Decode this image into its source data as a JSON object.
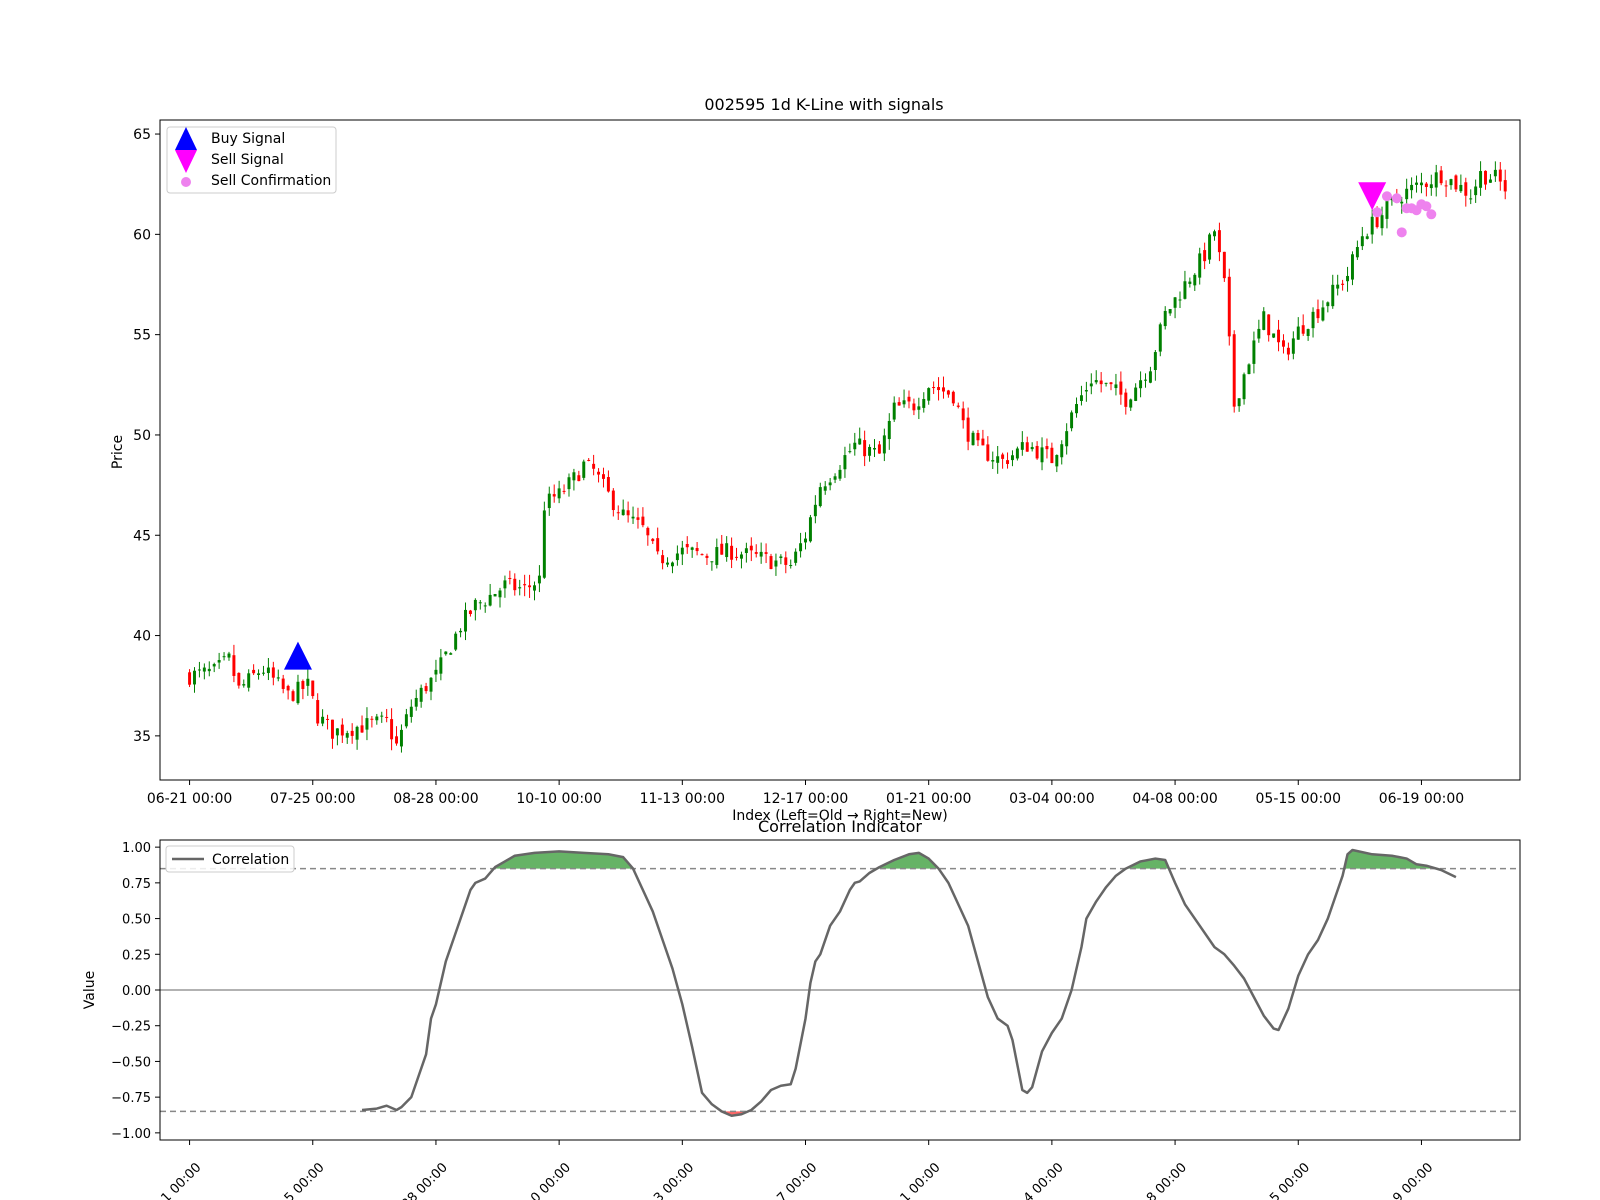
{
  "chart_data": [
    {
      "type": "candlestick",
      "title": "002595 1d K-Line with signals",
      "xlabel": "Index (Left=Old → Right=New)",
      "ylabel": "Price",
      "xlim": [
        -6,
        270
      ],
      "ylim": [
        32.8,
        65.7
      ],
      "yticks": [
        35,
        40,
        45,
        50,
        55,
        60,
        65
      ],
      "xtick_positions": [
        0,
        25,
        50,
        75,
        100,
        125,
        150,
        175,
        200,
        225,
        250
      ],
      "xtick_labels": [
        "06-21 00:00",
        "07-25 00:00",
        "08-28 00:00",
        "10-10 00:00",
        "11-13 00:00",
        "12-17 00:00",
        "01-21 00:00",
        "03-04 00:00",
        "04-08 00:00",
        "05-15 00:00",
        "06-19 00:00"
      ],
      "price_path": [
        [
          0,
          38.0
        ],
        [
          5,
          38.2
        ],
        [
          8,
          38.8
        ],
        [
          10,
          37.3
        ],
        [
          14,
          38.2
        ],
        [
          15,
          38.3
        ],
        [
          20,
          37.0
        ],
        [
          24,
          37.5
        ],
        [
          26,
          36.0
        ],
        [
          29,
          35.2
        ],
        [
          35,
          35.5
        ],
        [
          40,
          35.7
        ],
        [
          42,
          34.5
        ],
        [
          45,
          36.5
        ],
        [
          48,
          37.5
        ],
        [
          50,
          38.0
        ],
        [
          55,
          40.5
        ],
        [
          58,
          41.5
        ],
        [
          60,
          41.8
        ],
        [
          64,
          42.5
        ],
        [
          68,
          42.3
        ],
        [
          71,
          42.8
        ],
        [
          72,
          46.5
        ],
        [
          74,
          46.9
        ],
        [
          75,
          47.0
        ],
        [
          78,
          47.8
        ],
        [
          80,
          48.5
        ],
        [
          82,
          48.2
        ],
        [
          85,
          47.0
        ],
        [
          88,
          46.0
        ],
        [
          92,
          45.3
        ],
        [
          95,
          43.8
        ],
        [
          100,
          44.2
        ],
        [
          105,
          44.0
        ],
        [
          110,
          44.2
        ],
        [
          115,
          43.9
        ],
        [
          122,
          43.5
        ],
        [
          125,
          45.0
        ],
        [
          128,
          47.5
        ],
        [
          130,
          48.0
        ],
        [
          135,
          49.5
        ],
        [
          140,
          49.0
        ],
        [
          143,
          51.3
        ],
        [
          147,
          51.5
        ],
        [
          150,
          52.5
        ],
        [
          155,
          52.0
        ],
        [
          157,
          50.5
        ],
        [
          160,
          49.3
        ],
        [
          165,
          48.7
        ],
        [
          170,
          49.5
        ],
        [
          175,
          48.8
        ],
        [
          180,
          51.5
        ],
        [
          183,
          52.8
        ],
        [
          187,
          52.3
        ],
        [
          190,
          51.8
        ],
        [
          195,
          53.5
        ],
        [
          198,
          56.0
        ],
        [
          202,
          57.5
        ],
        [
          206,
          59.0
        ],
        [
          208,
          60.2
        ],
        [
          210,
          57.5
        ],
        [
          212,
          51.5
        ],
        [
          215,
          53.8
        ],
        [
          218,
          55.8
        ],
        [
          222,
          54.0
        ],
        [
          225,
          55.2
        ],
        [
          230,
          56.5
        ],
        [
          235,
          58.0
        ],
        [
          238,
          60.0
        ],
        [
          242,
          61.0
        ],
        [
          246,
          62.0
        ],
        [
          250,
          62.5
        ],
        [
          254,
          63.0
        ],
        [
          257,
          62.5
        ],
        [
          260,
          62.0
        ],
        [
          262,
          63.0
        ],
        [
          265,
          62.8
        ],
        [
          267,
          62.3
        ]
      ],
      "candles_count": 268,
      "up_color": "#008000",
      "down_color": "#ff0000",
      "signals": [
        {
          "name": "Buy Signal",
          "marker": "triangle-up",
          "color": "#0000ff",
          "points": [
            [
              22,
              38.9
            ]
          ]
        },
        {
          "name": "Sell Signal",
          "marker": "triangle-down",
          "color": "#ff00ff",
          "points": [
            [
              240,
              62.0
            ]
          ]
        },
        {
          "name": "Sell Confirmation",
          "marker": "circle",
          "color": "#ee82ee",
          "points": [
            [
              241,
              61.1
            ],
            [
              243,
              61.9
            ],
            [
              245,
              61.8
            ],
            [
              246,
              60.1
            ],
            [
              247,
              61.3
            ],
            [
              248,
              61.3
            ],
            [
              249,
              61.2
            ],
            [
              250,
              61.5
            ],
            [
              251,
              61.4
            ],
            [
              252,
              61.0
            ]
          ]
        }
      ],
      "legend": {
        "position": "upper-left",
        "entries": [
          "Buy Signal",
          "Sell Signal",
          "Sell Confirmation"
        ]
      }
    },
    {
      "type": "line",
      "title": "Correlation Indicator",
      "xlabel": "",
      "ylabel": "Value",
      "xlim": [
        -6,
        270
      ],
      "ylim": [
        -1.05,
        1.05
      ],
      "yticks": [
        -1.0,
        -0.75,
        -0.5,
        -0.25,
        0.0,
        0.25,
        0.5,
        0.75,
        1.0
      ],
      "ytick_labels": [
        "−1.00",
        "−0.75",
        "−0.50",
        "−0.25",
        "0.00",
        "0.25",
        "0.50",
        "0.75",
        "1.00"
      ],
      "xtick_labels_visible": [
        "1 00:00",
        "5 00:00",
        "28 00:00",
        "0 00:00",
        "3 00:00",
        "7 00:00",
        "1 00:00",
        "4 00:00",
        "8 00:00",
        "5 00:00",
        "9 00:00"
      ],
      "xtick_positions": [
        0,
        25,
        50,
        75,
        100,
        125,
        150,
        175,
        200,
        225,
        250
      ],
      "thresholds": [
        0.85,
        -0.85
      ],
      "zero_line": 0.0,
      "series": [
        {
          "name": "Correlation",
          "color": "#666666",
          "points": [
            [
              35,
              -0.84
            ],
            [
              38,
              -0.83
            ],
            [
              40,
              -0.81
            ],
            [
              42,
              -0.84
            ],
            [
              43,
              -0.82
            ],
            [
              45,
              -0.75
            ],
            [
              46,
              -0.65
            ],
            [
              48,
              -0.45
            ],
            [
              49,
              -0.2
            ],
            [
              50,
              -0.1
            ],
            [
              52,
              0.2
            ],
            [
              54,
              0.4
            ],
            [
              56,
              0.6
            ],
            [
              57,
              0.7
            ],
            [
              58,
              0.75
            ],
            [
              60,
              0.78
            ],
            [
              61,
              0.82
            ],
            [
              62,
              0.86
            ],
            [
              64,
              0.9
            ],
            [
              66,
              0.94
            ],
            [
              70,
              0.96
            ],
            [
              75,
              0.97
            ],
            [
              80,
              0.96
            ],
            [
              85,
              0.95
            ],
            [
              88,
              0.93
            ],
            [
              90,
              0.85
            ],
            [
              92,
              0.7
            ],
            [
              94,
              0.55
            ],
            [
              96,
              0.35
            ],
            [
              98,
              0.15
            ],
            [
              100,
              -0.1
            ],
            [
              102,
              -0.4
            ],
            [
              104,
              -0.72
            ],
            [
              106,
              -0.8
            ],
            [
              108,
              -0.85
            ],
            [
              110,
              -0.88
            ],
            [
              112,
              -0.87
            ],
            [
              114,
              -0.84
            ],
            [
              116,
              -0.78
            ],
            [
              118,
              -0.7
            ],
            [
              120,
              -0.67
            ],
            [
              122,
              -0.66
            ],
            [
              123,
              -0.55
            ],
            [
              125,
              -0.2
            ],
            [
              126,
              0.05
            ],
            [
              127,
              0.2
            ],
            [
              128,
              0.25
            ],
            [
              130,
              0.45
            ],
            [
              132,
              0.55
            ],
            [
              134,
              0.7
            ],
            [
              135,
              0.75
            ],
            [
              136,
              0.76
            ],
            [
              138,
              0.82
            ],
            [
              140,
              0.86
            ],
            [
              143,
              0.91
            ],
            [
              146,
              0.95
            ],
            [
              148,
              0.96
            ],
            [
              150,
              0.92
            ],
            [
              152,
              0.85
            ],
            [
              154,
              0.75
            ],
            [
              156,
              0.6
            ],
            [
              158,
              0.45
            ],
            [
              160,
              0.2
            ],
            [
              162,
              -0.05
            ],
            [
              164,
              -0.2
            ],
            [
              166,
              -0.25
            ],
            [
              167,
              -0.35
            ],
            [
              169,
              -0.7
            ],
            [
              170,
              -0.72
            ],
            [
              171,
              -0.68
            ],
            [
              173,
              -0.43
            ],
            [
              175,
              -0.3
            ],
            [
              177,
              -0.2
            ],
            [
              179,
              0.0
            ],
            [
              181,
              0.3
            ],
            [
              182,
              0.5
            ],
            [
              184,
              0.62
            ],
            [
              186,
              0.72
            ],
            [
              188,
              0.8
            ],
            [
              190,
              0.85
            ],
            [
              193,
              0.9
            ],
            [
              196,
              0.92
            ],
            [
              198,
              0.91
            ],
            [
              200,
              0.75
            ],
            [
              202,
              0.6
            ],
            [
              205,
              0.45
            ],
            [
              208,
              0.3
            ],
            [
              210,
              0.25
            ],
            [
              212,
              0.17
            ],
            [
              214,
              0.08
            ],
            [
              216,
              -0.05
            ],
            [
              218,
              -0.18
            ],
            [
              220,
              -0.27
            ],
            [
              221,
              -0.28
            ],
            [
              223,
              -0.13
            ],
            [
              225,
              0.1
            ],
            [
              227,
              0.25
            ],
            [
              229,
              0.35
            ],
            [
              231,
              0.5
            ],
            [
              233,
              0.7
            ],
            [
              234,
              0.8
            ],
            [
              235,
              0.95
            ],
            [
              236,
              0.98
            ],
            [
              240,
              0.95
            ],
            [
              244,
              0.94
            ],
            [
              247,
              0.92
            ],
            [
              249,
              0.88
            ],
            [
              251,
              0.87
            ],
            [
              254,
              0.84
            ],
            [
              257,
              0.79
            ]
          ]
        }
      ],
      "fill_above_color": "#008000",
      "fill_below_color": "#ff0000",
      "legend": {
        "position": "upper-left",
        "entries": [
          "Correlation"
        ]
      }
    }
  ]
}
